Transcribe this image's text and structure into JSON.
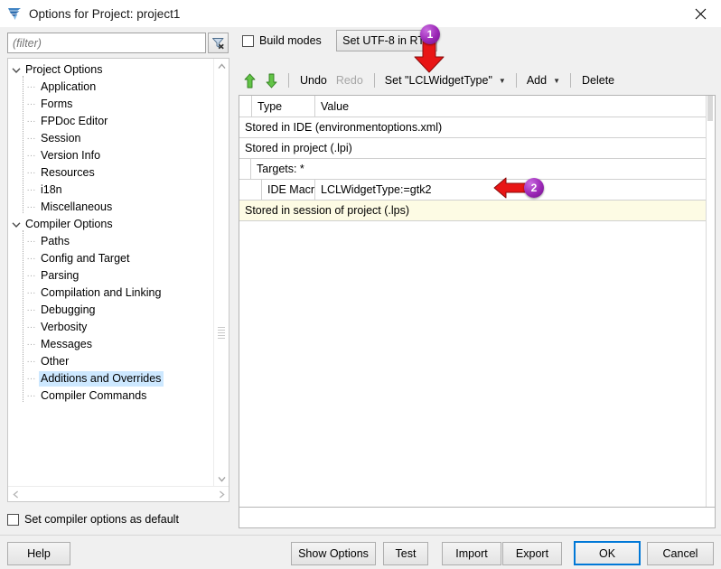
{
  "window": {
    "title": "Options for Project: project1",
    "icon": "lazarus-tornado-icon",
    "close_label": "✕"
  },
  "left_panel": {
    "filter": {
      "value": "",
      "placeholder": "(filter)",
      "clear_button_icon": "funnel-clear-icon"
    },
    "tree": [
      {
        "label": "Project Options",
        "level": 0,
        "expanded": true,
        "selected": false
      },
      {
        "label": "Application",
        "level": 1,
        "expanded": false,
        "selected": false
      },
      {
        "label": "Forms",
        "level": 1,
        "expanded": false,
        "selected": false
      },
      {
        "label": "FPDoc Editor",
        "level": 1,
        "expanded": false,
        "selected": false
      },
      {
        "label": "Session",
        "level": 1,
        "expanded": false,
        "selected": false
      },
      {
        "label": "Version Info",
        "level": 1,
        "expanded": false,
        "selected": false
      },
      {
        "label": "Resources",
        "level": 1,
        "expanded": false,
        "selected": false
      },
      {
        "label": "i18n",
        "level": 1,
        "expanded": false,
        "selected": false
      },
      {
        "label": "Miscellaneous",
        "level": 1,
        "expanded": false,
        "selected": false
      },
      {
        "label": "Compiler Options",
        "level": 0,
        "expanded": true,
        "selected": false
      },
      {
        "label": "Paths",
        "level": 1,
        "expanded": false,
        "selected": false
      },
      {
        "label": "Config and Target",
        "level": 1,
        "expanded": false,
        "selected": false
      },
      {
        "label": "Parsing",
        "level": 1,
        "expanded": false,
        "selected": false
      },
      {
        "label": "Compilation and Linking",
        "level": 1,
        "expanded": false,
        "selected": false
      },
      {
        "label": "Debugging",
        "level": 1,
        "expanded": false,
        "selected": false
      },
      {
        "label": "Verbosity",
        "level": 1,
        "expanded": false,
        "selected": false
      },
      {
        "label": "Messages",
        "level": 1,
        "expanded": false,
        "selected": false
      },
      {
        "label": "Other",
        "level": 1,
        "expanded": false,
        "selected": false
      },
      {
        "label": "Additions and Overrides",
        "level": 1,
        "expanded": false,
        "selected": true
      },
      {
        "label": "Compiler Commands",
        "level": 1,
        "expanded": false,
        "selected": false
      }
    ],
    "expand_glyph": "⌄",
    "child_glyph": "···"
  },
  "top_bar": {
    "build_modes_label": "Build modes",
    "build_modes_checked": false,
    "utf8_button_label": "Set UTF-8 in RTL"
  },
  "grid_toolbar": {
    "move_up_icon": "arrow-up-green-icon",
    "move_down_icon": "arrow-down-green-icon",
    "undo_label": "Undo",
    "undo_enabled": true,
    "redo_label": "Redo",
    "redo_enabled": false,
    "set_label": "Set \"LCLWidgetType\"",
    "add_label": "Add",
    "delete_label": "Delete",
    "caret_glyph": "▼"
  },
  "grid": {
    "columns": [
      "Type",
      "Value"
    ],
    "rows": [
      {
        "kind": "group",
        "indent": 0,
        "text": "Stored in IDE (environmentoptions.xml)"
      },
      {
        "kind": "group",
        "indent": 0,
        "text": "Stored in project (.lpi)"
      },
      {
        "kind": "group",
        "indent": 1,
        "text": "Targets: *"
      },
      {
        "kind": "entry",
        "indent": 2,
        "type": "IDE Macro",
        "value": "LCLWidgetType:=gtk2"
      },
      {
        "kind": "session",
        "indent": 0,
        "text": "Stored in session of project (.lps)"
      }
    ]
  },
  "annotations": [
    {
      "id": "1",
      "label": "1",
      "arrow": "down-arrow-red",
      "target": "set-lclwidgettype-dropdown"
    },
    {
      "id": "2",
      "label": "2",
      "arrow": "left-arrow-red",
      "target": "ide-macro-value-cell"
    }
  ],
  "bottom": {
    "default_checkbox_label": "Set compiler options as default",
    "default_checkbox_checked": false,
    "buttons": {
      "help": "Help",
      "show_options": "Show Options",
      "test": "Test",
      "import": "Import",
      "export": "Export",
      "ok": "OK",
      "cancel": "Cancel"
    }
  },
  "colors": {
    "accent_blue": "#0078d7",
    "selection_blue": "#cde8ff",
    "annotation_purple": "#9b27b6",
    "annotation_red": "#e81515",
    "green_arrow": "#4aa832",
    "session_row": "#fdfbe4"
  }
}
